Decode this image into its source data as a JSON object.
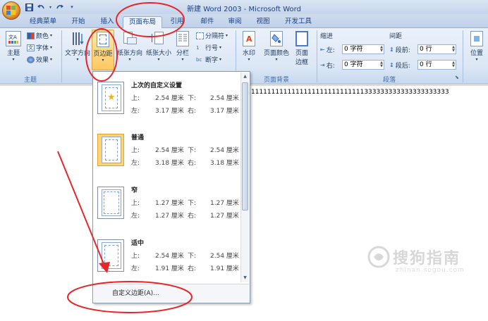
{
  "window": {
    "title": "新建 Word 2003 - Microsoft Word"
  },
  "quick_access": [
    "save-icon",
    "undo-icon",
    "redo-icon",
    "customize-icon"
  ],
  "tabs": [
    {
      "label": "经典菜单"
    },
    {
      "label": "开始"
    },
    {
      "label": "插入"
    },
    {
      "label": "页面布局",
      "active": true
    },
    {
      "label": "引用"
    },
    {
      "label": "邮件"
    },
    {
      "label": "审阅"
    },
    {
      "label": "视图"
    },
    {
      "label": "开发工具"
    }
  ],
  "ribbon": {
    "theme_group": {
      "label": "主题",
      "themes_button": "主题",
      "colors": "颜色",
      "fonts": "字体",
      "effects": "效果"
    },
    "page_setup_group": {
      "text_direction": "文字方向",
      "margins": "页边距",
      "orientation": "纸张方向",
      "size": "纸张大小",
      "columns": "分栏",
      "breaks": "分隔符",
      "line_numbers": "行号",
      "hyphenation": "断字"
    },
    "page_background_group": {
      "label": "页面背景",
      "watermark": "水印",
      "page_color": "页面颜色",
      "page_borders_line1": "页面",
      "page_borders_line2": "边框"
    },
    "paragraph_group": {
      "label": "段落",
      "indent_title": "缩进",
      "indent_left_label": "左:",
      "indent_left_value": "0 字符",
      "indent_right_label": "右:",
      "indent_right_value": "0 字符",
      "spacing_title": "间距",
      "spacing_before_label": "段前:",
      "spacing_before_value": "0 行",
      "spacing_after_label": "段后:",
      "spacing_after_value": "0 行"
    },
    "arrange_group": {
      "position": "位置"
    }
  },
  "document": {
    "text": "1111111111111111111111111111333333333333333333333"
  },
  "margins_menu": {
    "items": [
      {
        "title": "上次的自定义设置",
        "top_label": "上:",
        "top": "2.54 厘米",
        "bottom_label": "下:",
        "bottom": "2.54 厘米",
        "left_label": "左:",
        "left": "3.17 厘米",
        "right_label": "右:",
        "right": "3.17 厘米",
        "icon": "star-icon"
      },
      {
        "title": "普通",
        "top_label": "上:",
        "top": "2.54 厘米",
        "bottom_label": "下:",
        "bottom": "2.54 厘米",
        "left_label": "左:",
        "left": "3.18 厘米",
        "right_label": "右:",
        "right": "3.18 厘米",
        "selected": true
      },
      {
        "title": "窄",
        "top_label": "上:",
        "top": "1.27 厘米",
        "bottom_label": "下:",
        "bottom": "1.27 厘米",
        "left_label": "左:",
        "left": "1.27 厘米",
        "right_label": "右:",
        "right": "1.27 厘米"
      },
      {
        "title": "适中",
        "top_label": "上:",
        "top": "2.54 厘米",
        "bottom_label": "下:",
        "bottom": "2.54 厘米",
        "left_label": "左:",
        "left": "1.91 厘米",
        "right_label": "右:",
        "right": "1.91 厘米"
      }
    ],
    "custom_margins": "自定义边距(A)..."
  },
  "watermark_text": {
    "main": "搜狗指南",
    "url": "zhinan.sogou.com"
  },
  "colors": {
    "annotation_red": "#e8262a",
    "ribbon_blue": "#15428b"
  }
}
